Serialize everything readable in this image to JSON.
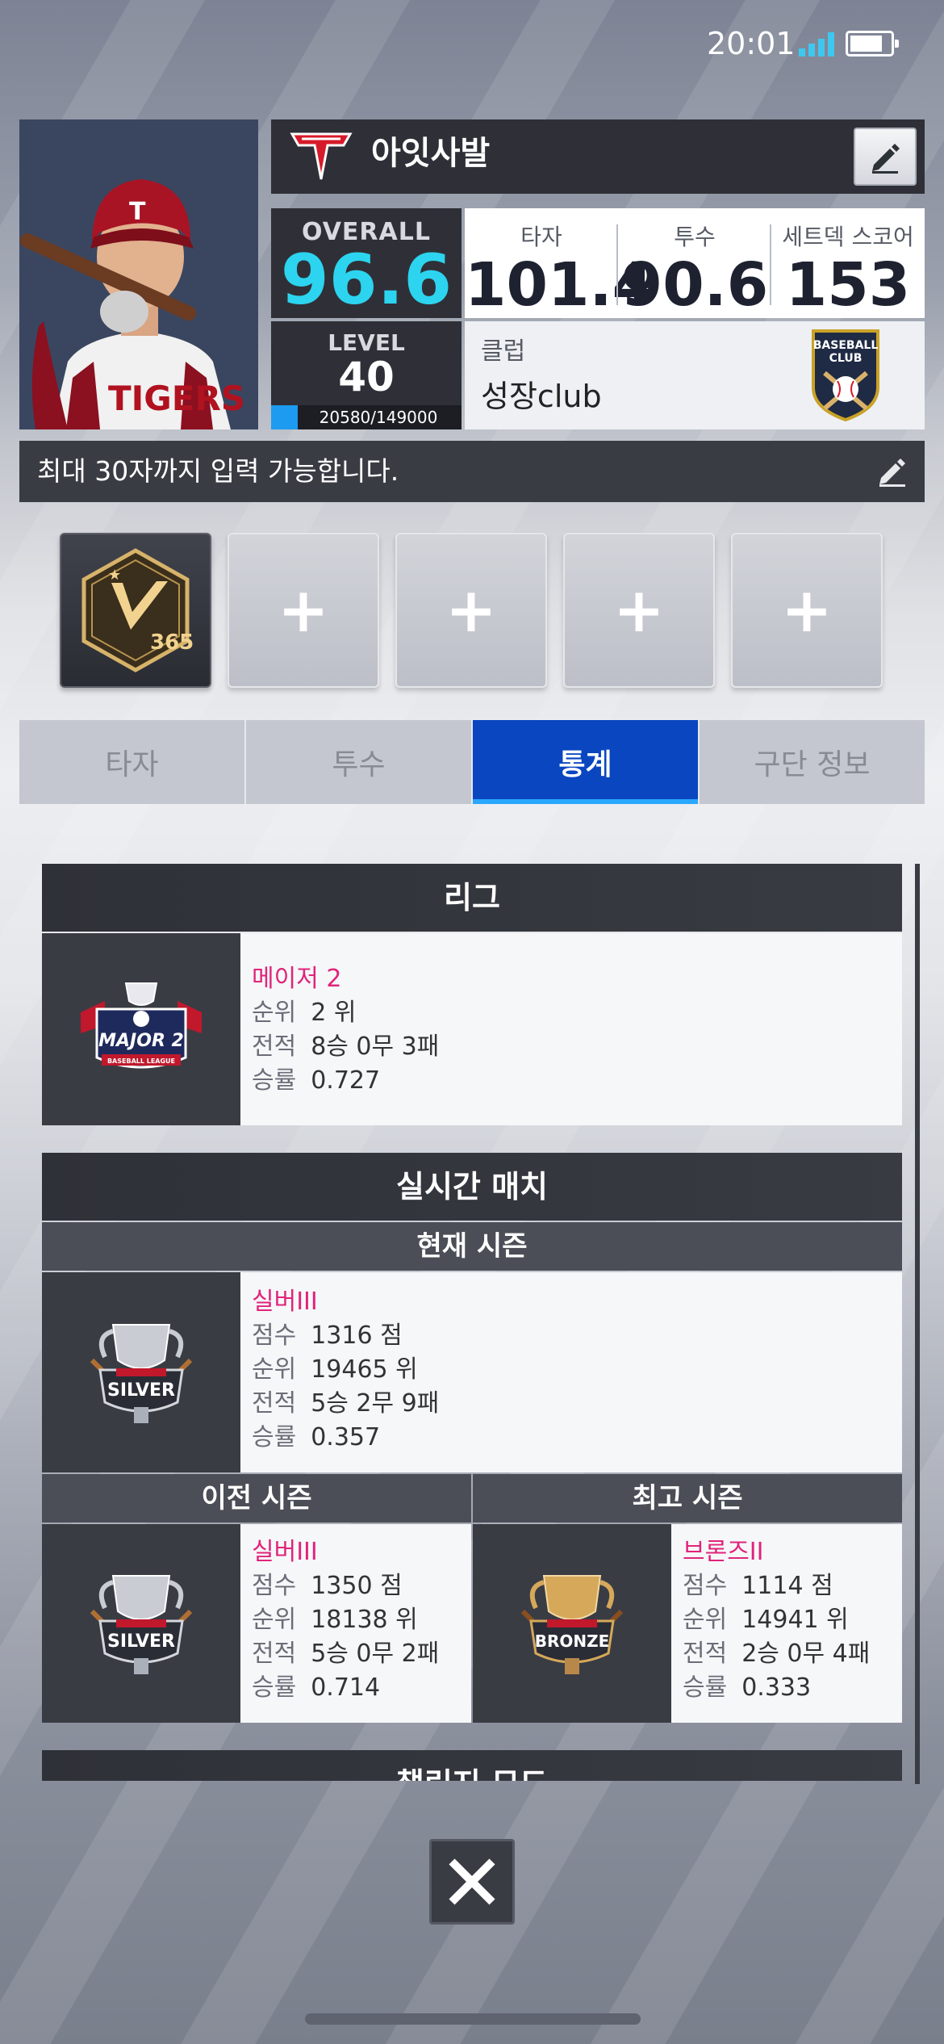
{
  "status_bar": {
    "time": "20:01"
  },
  "player": {
    "name": "아잇사발",
    "overall_label": "OVERALL",
    "overall": "96.6",
    "level_label": "LEVEL",
    "level": "40",
    "xp_text": "20580/149000",
    "xp_progress": 0.138
  },
  "stats": {
    "batter_label": "타자",
    "batter_value": "101.4",
    "pitcher_label": "투수",
    "pitcher_value": "90.6",
    "setdeck_label": "세트덱 스코어",
    "setdeck_value": "153"
  },
  "club": {
    "label": "클럽",
    "name": "성장club",
    "logo_text_1": "BASEBALL",
    "logo_text_2": "CLUB"
  },
  "bio": {
    "placeholder": "최대 30자까지 입력 가능합니다."
  },
  "badges": {
    "badge_1_text": "365",
    "empty_glyph": "+"
  },
  "tabs": [
    {
      "label": "타자"
    },
    {
      "label": "투수"
    },
    {
      "label": "통계",
      "active": true
    },
    {
      "label": "구단 정보"
    }
  ],
  "league": {
    "title": "리그",
    "emblem_text": "MAJOR 2",
    "emblem_sub": "BASEBALL LEAGUE",
    "tier": "메이저 2",
    "rank_key": "순위",
    "rank_val": "2 위",
    "record_key": "전적",
    "record_val": "8승 0무 3패",
    "rate_key": "승률",
    "rate_val": "0.727"
  },
  "realtime": {
    "title": "실시간 매치",
    "current_title": "현재 시즌",
    "current": {
      "emblem_text": "SILVER",
      "tier": "실버III",
      "score_key": "점수",
      "score_val": "1316 점",
      "rank_key": "순위",
      "rank_val": "19465 위",
      "record_key": "전적",
      "record_val": "5승 2무 9패",
      "rate_key": "승률",
      "rate_val": "0.357"
    },
    "previous_title": "이전 시즌",
    "previous": {
      "emblem_text": "SILVER",
      "tier": "실버III",
      "score_key": "점수",
      "score_val": "1350 점",
      "rank_key": "순위",
      "rank_val": "18138 위",
      "record_key": "전적",
      "record_val": "5승 0무 2패",
      "rate_key": "승률",
      "rate_val": "0.714"
    },
    "best_title": "최고 시즌",
    "best": {
      "emblem_text": "BRONZE",
      "tier": "브론즈II",
      "score_key": "점수",
      "score_val": "1114 점",
      "rank_key": "순위",
      "rank_val": "14941 위",
      "record_key": "전적",
      "record_val": "2승 0무 4패",
      "rate_key": "승률",
      "rate_val": "0.333"
    }
  },
  "challenge": {
    "title": "챌린지 모드"
  },
  "colors": {
    "accent_blue": "#0a46c0",
    "overall_cyan": "#2cd4ef",
    "tier_pink": "#e0247a"
  }
}
